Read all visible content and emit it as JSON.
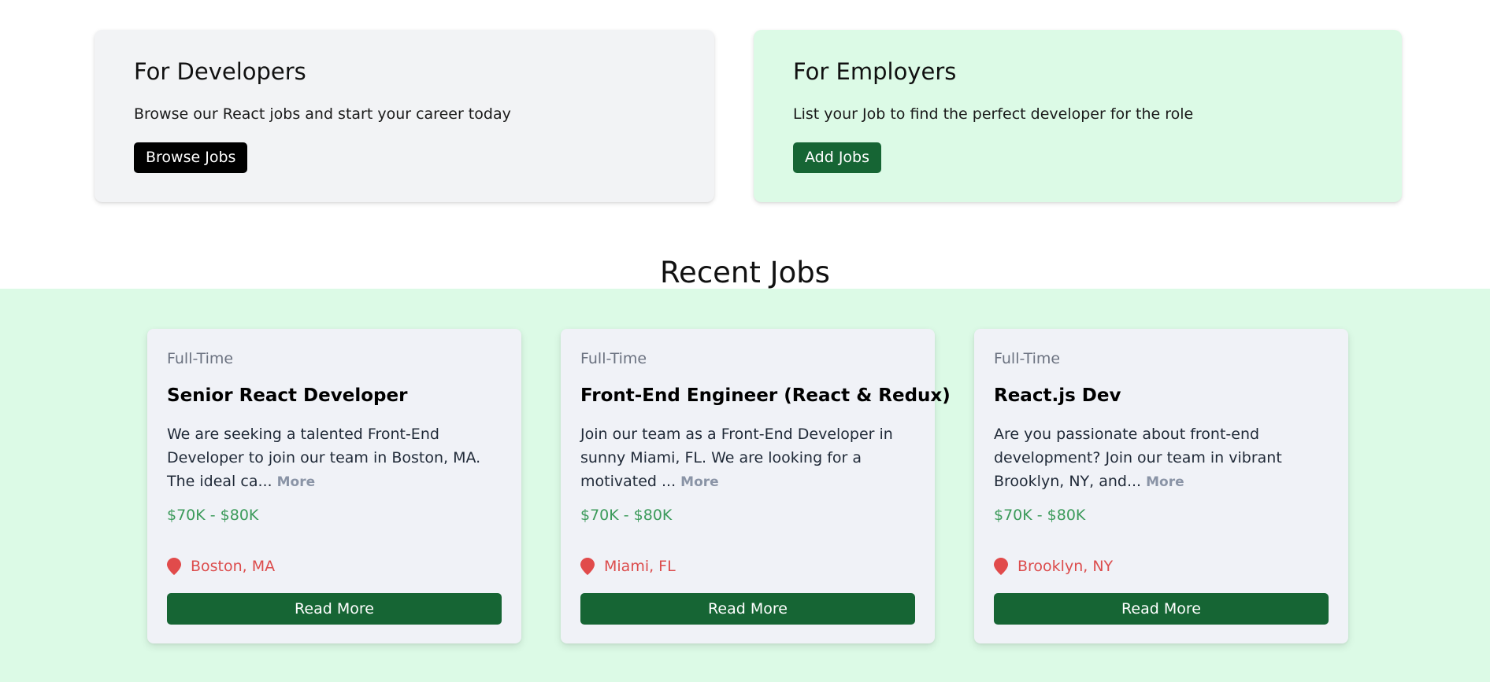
{
  "hero": {
    "developers": {
      "title": "For Developers",
      "text": "Browse our React jobs and start your career today",
      "button": "Browse Jobs"
    },
    "employers": {
      "title": "For Employers",
      "text": "List your Job to find the perfect developer for the role",
      "button": "Add Jobs"
    }
  },
  "recent": {
    "title": "Recent Jobs",
    "jobs": [
      {
        "type": "Full-Time",
        "title": "Senior React Developer",
        "description": "We are seeking a talented Front-End Developer to join our team in Boston, MA. The ideal ca...",
        "more": "More",
        "salary": "$70K - $80K",
        "location": "Boston, MA",
        "button": "Read More"
      },
      {
        "type": "Full-Time",
        "title": "Front-End Engineer (React & Redux)",
        "description": "Join our team as a Front-End Developer in sunny Miami, FL. We are looking for a motivated ...",
        "more": "More",
        "salary": "$70K - $80K",
        "location": "Miami, FL",
        "button": "Read More"
      },
      {
        "type": "Full-Time",
        "title": "React.js Dev",
        "description": "Are you passionate about front-end development? Join our team in vibrant Brooklyn, NY, and...",
        "more": "More",
        "salary": "$70K - $80K",
        "location": "Brooklyn, NY",
        "button": "Read More"
      }
    ]
  },
  "colors": {
    "primary_green": "#166534",
    "band_green": "#dcfae6",
    "location_red": "#dc4c4c",
    "salary_green": "#3b9a5a"
  },
  "icons": {
    "location": "map-pin-icon"
  }
}
